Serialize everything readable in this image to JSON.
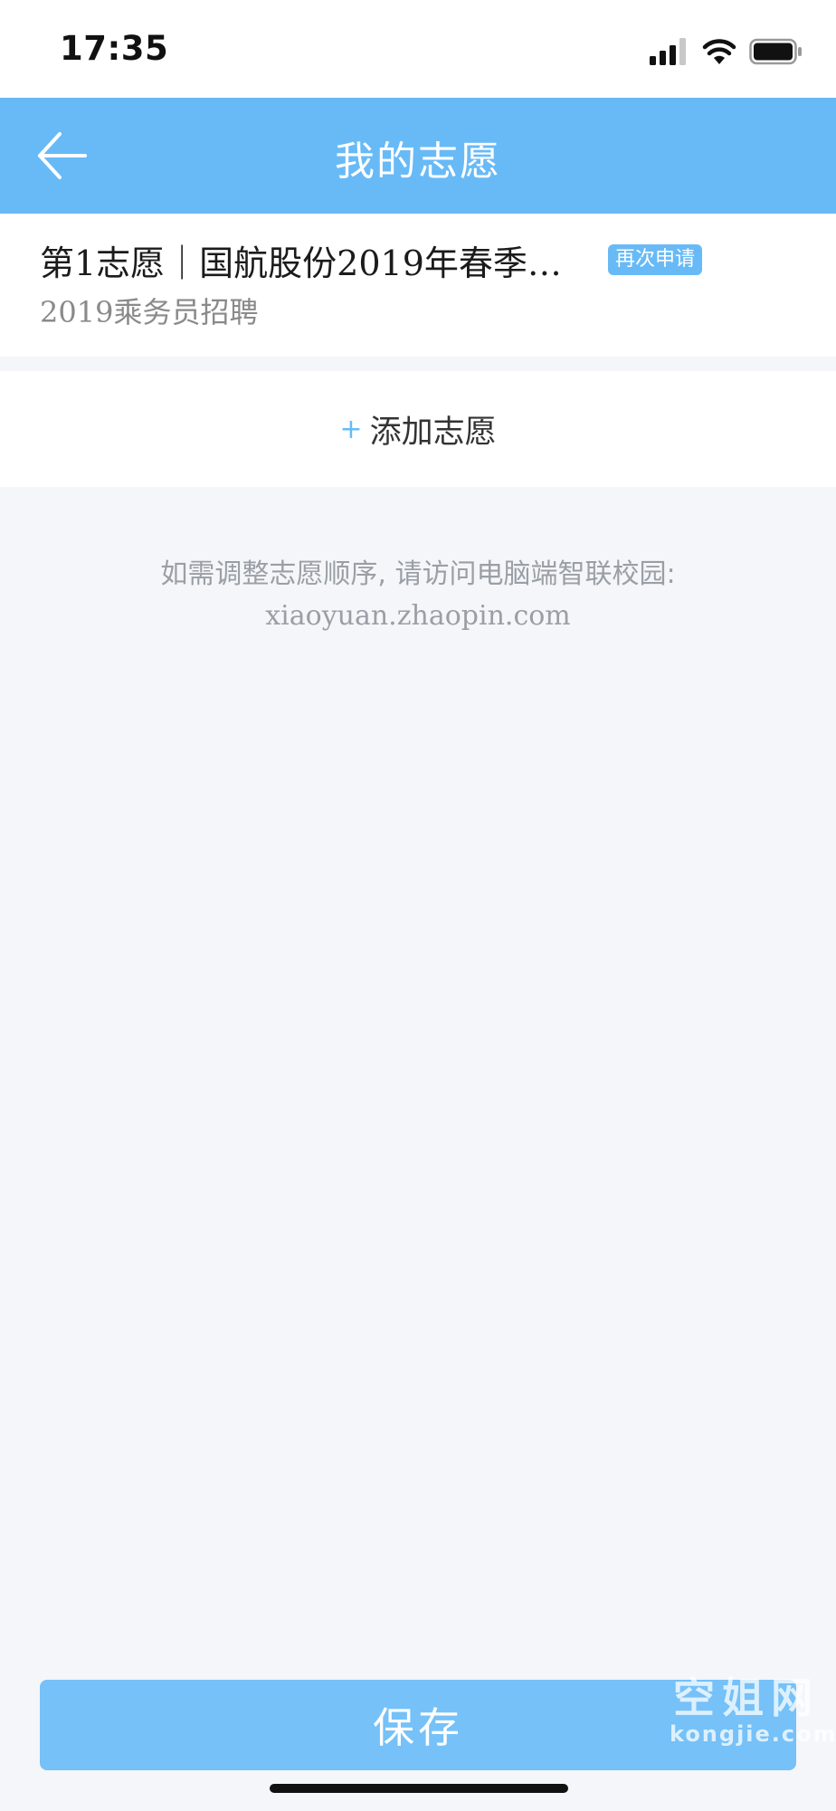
{
  "status_bar": {
    "time": "17:35",
    "icons": [
      "signal-icon",
      "wifi-icon",
      "battery-icon"
    ]
  },
  "nav": {
    "title": "我的志愿",
    "back_icon": "back-arrow-icon"
  },
  "wish_item": {
    "title": "第1志愿｜国航股份2019年春季…",
    "subtitle": "2019乘务员招聘",
    "badge": "再次申请"
  },
  "add_wish": {
    "icon": "+",
    "label": "添加志愿"
  },
  "hint": {
    "line1": "如需调整志愿顺序, 请访问电脑端智联校园:",
    "line2": "xiaoyuan.zhaopin.com"
  },
  "save_label": "保存",
  "watermark": {
    "main": "空姐网",
    "sub": "kongjie.com"
  },
  "colors": {
    "accent": "#68baf7",
    "save_button": "#76c1f8",
    "background": "#f4f6f9"
  }
}
